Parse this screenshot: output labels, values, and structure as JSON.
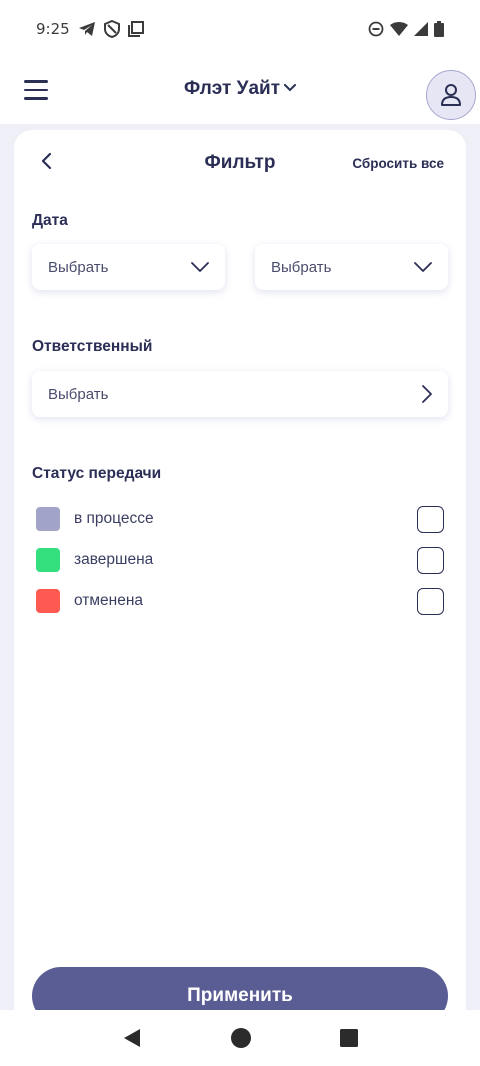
{
  "status_bar": {
    "time": "9:25",
    "icons_left": [
      "telegram-icon",
      "shield-icon",
      "copy-icon"
    ],
    "icons_right": [
      "do-not-disturb-icon",
      "wifi-icon",
      "signal-icon",
      "battery-icon"
    ]
  },
  "app_bar": {
    "company_name": "Флэт Уайт"
  },
  "filter": {
    "title": "Фильтр",
    "reset_label": "Сбросить все",
    "date": {
      "label": "Дата",
      "from_placeholder": "Выбрать",
      "to_placeholder": "Выбрать"
    },
    "responsible": {
      "label": "Ответственный",
      "placeholder": "Выбрать"
    },
    "transfer_status": {
      "label": "Статус передачи",
      "items": [
        {
          "label": "в процессе",
          "color": "#a1a3c9",
          "checked": false
        },
        {
          "label": "завершена",
          "color": "#34e07d",
          "checked": false
        },
        {
          "label": "отменена",
          "color": "#ff5a52",
          "checked": false
        }
      ]
    },
    "apply_label": "Применить"
  },
  "colors": {
    "primary": "#5a5d94",
    "text": "#2b2e55",
    "background": "#eeeff7"
  }
}
